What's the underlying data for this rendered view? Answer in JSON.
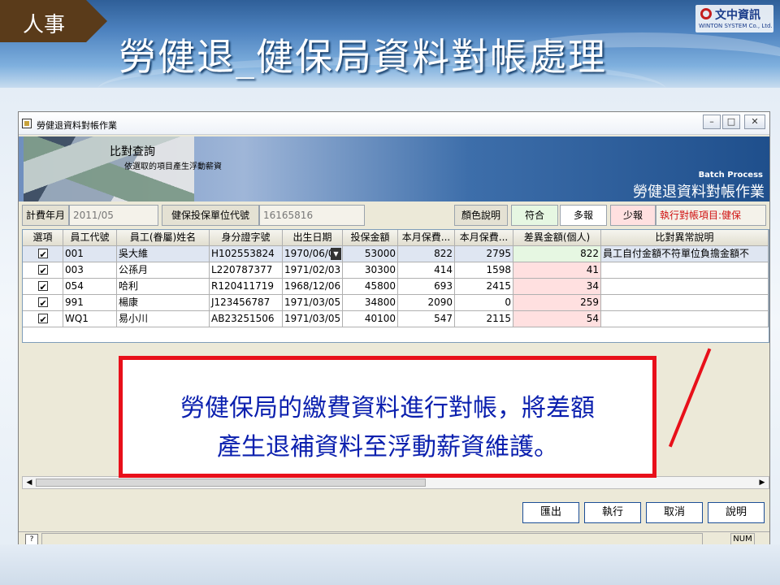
{
  "slide": {
    "section_tag": "人事",
    "title": "勞健退_健保局資料對帳處理",
    "brand_name": "文中資訊",
    "brand_sub": "WINTON SYSTEM Co., Ltd."
  },
  "window": {
    "title": "勞健退資料對帳作業",
    "min_glyph": "–",
    "max_glyph": "□",
    "close_glyph": "✕"
  },
  "banner": {
    "title": "比對查詢",
    "subtitle": "依選取的項目產生浮動薪資",
    "batch_label": "Batch Process",
    "program_title": "勞健退資料對帳作業"
  },
  "filter": {
    "period_label": "計費年月",
    "period_value": "2011/05",
    "unit_label": "健保投保單位代號",
    "unit_value": "16165816",
    "color_legend_label": "顏色說明",
    "legend_match": "符合",
    "legend_over": "多報",
    "legend_under": "少報",
    "exec_item": "執行對帳項目:健保"
  },
  "grid": {
    "headers": [
      "選項",
      "員工代號",
      "員工(眷屬)姓名",
      "身分證字號",
      "出生日期",
      "投保金額",
      "本月保費...",
      "本月保費...",
      "差異金額(個人)",
      "比對異常說明"
    ],
    "rows": [
      {
        "emp_id": "001",
        "name": "吳大維",
        "id_no": "H102553824",
        "birth": "1970/06/0",
        "insured": "53000",
        "fee1": "822",
        "fee2": "2795",
        "diff": "822",
        "note": "員工自付金額不符單位負擔金額不"
      },
      {
        "emp_id": "003",
        "name": "公孫月",
        "id_no": "L220787377",
        "birth": "1971/02/03",
        "insured": "30300",
        "fee1": "414",
        "fee2": "1598",
        "diff": "41",
        "note": ""
      },
      {
        "emp_id": "054",
        "name": "哈利",
        "id_no": "R120411719",
        "birth": "1968/12/06",
        "insured": "45800",
        "fee1": "693",
        "fee2": "2415",
        "diff": "34",
        "note": ""
      },
      {
        "emp_id": "991",
        "name": "楊康",
        "id_no": "J123456787",
        "birth": "1971/03/05",
        "insured": "34800",
        "fee1": "2090",
        "fee2": "0",
        "diff": "259",
        "note": ""
      },
      {
        "emp_id": "WQ1",
        "name": "易小川",
        "id_no": "AB23251506",
        "birth": "1971/03/05",
        "insured": "40100",
        "fee1": "547",
        "fee2": "2115",
        "diff": "54",
        "note": ""
      }
    ]
  },
  "buttons": {
    "export": "匯出",
    "execute": "執行",
    "cancel": "取消",
    "help": "說明"
  },
  "status": {
    "help_glyph": "?",
    "num_indicator": "NUM"
  },
  "callout": {
    "line1": "勞健保局的繳費資料進行對帳，將差額",
    "line2": "產生退補資料至浮動薪資維護。"
  },
  "colors": {
    "accent_red": "#e8101a",
    "callout_text": "#0a1fae",
    "diff_pink": "#ffe0e0",
    "match_green": "#e6f7e2"
  }
}
